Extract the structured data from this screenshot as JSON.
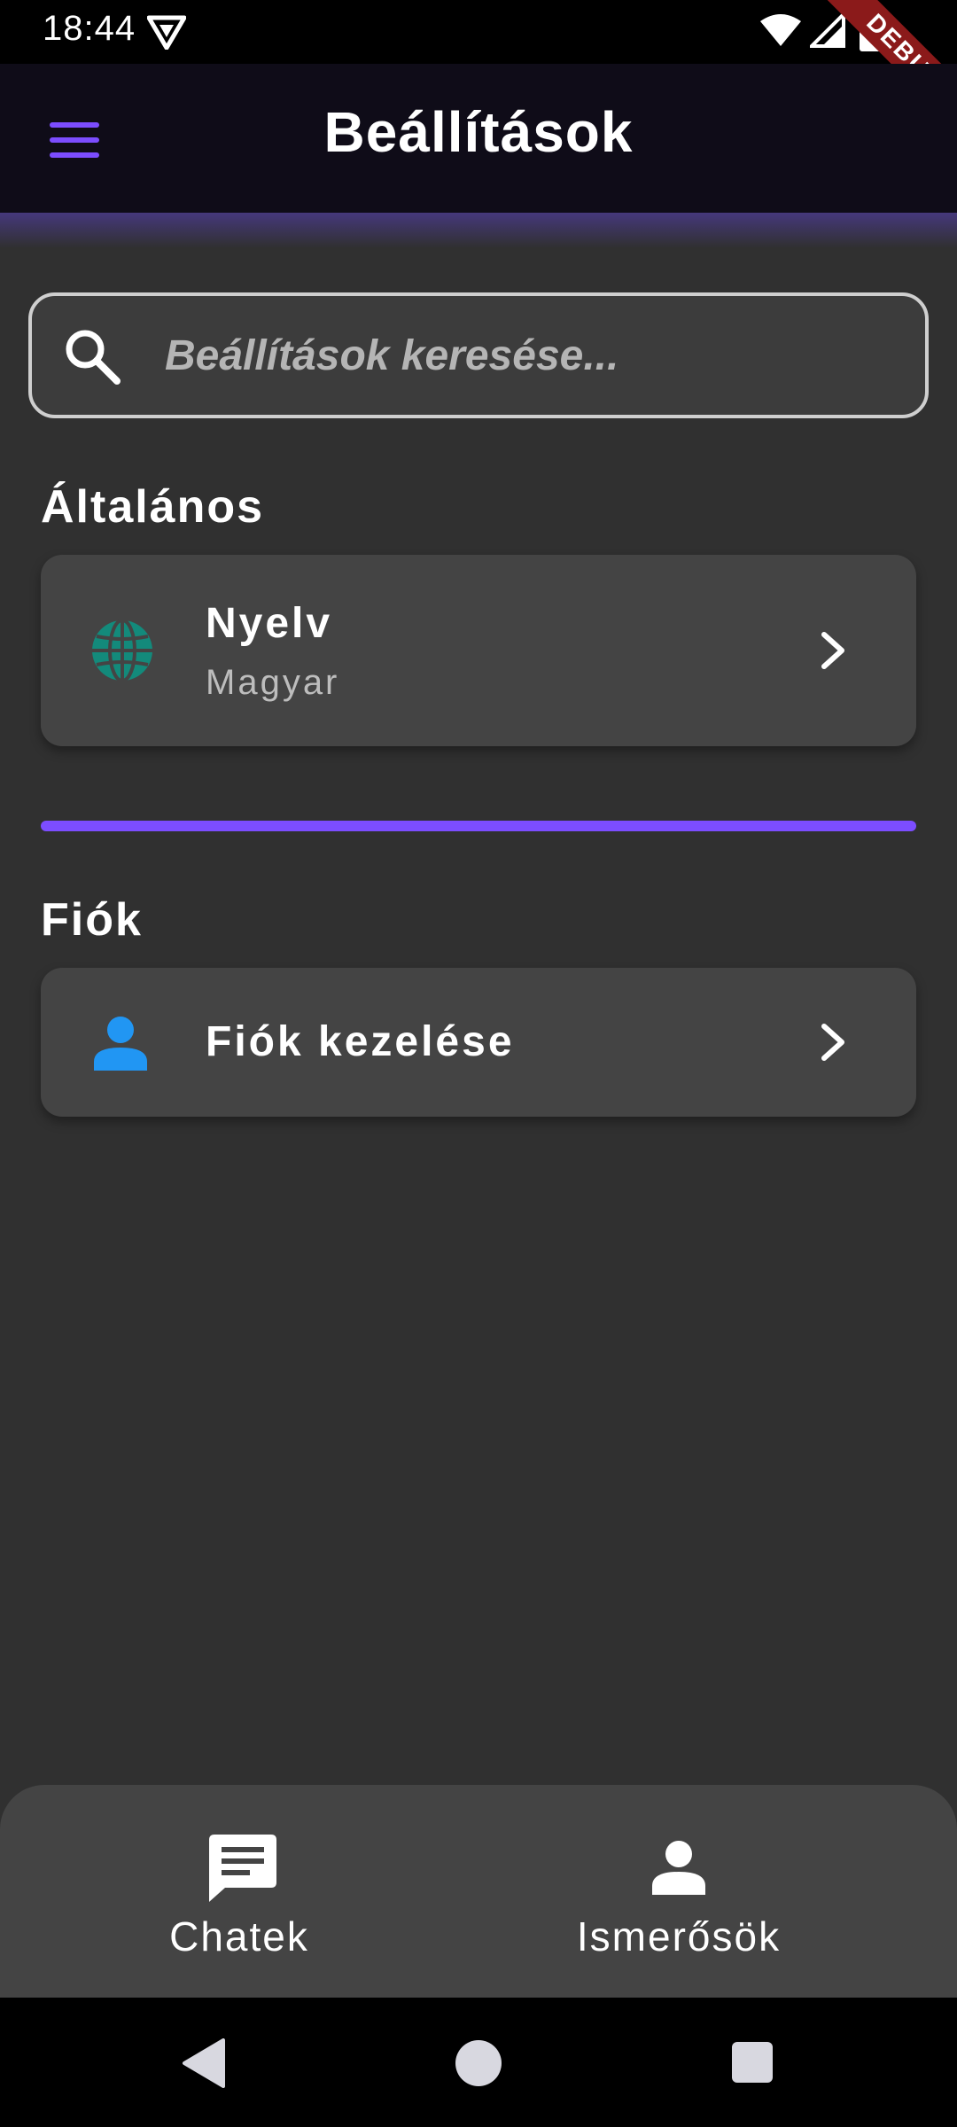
{
  "status_bar": {
    "time": "18:44",
    "debug_label": "DEBUG"
  },
  "app_bar": {
    "title": "Beállítások",
    "accent_color": "#7c4dff"
  },
  "search": {
    "placeholder": "Beállítások keresése..."
  },
  "sections": {
    "general": {
      "title": "Általános",
      "language": {
        "title": "Nyelv",
        "subtitle": "Magyar",
        "icon": "globe-icon",
        "icon_color": "#138a7b"
      }
    },
    "account": {
      "title": "Fiók",
      "manage": {
        "title": "Fiók kezelése",
        "icon": "person-icon",
        "icon_color": "#2196f3"
      }
    }
  },
  "bottom_nav": {
    "chats": {
      "label": "Chatek",
      "icon": "chat-icon"
    },
    "contacts": {
      "label": "Ismerősök",
      "icon": "person-icon"
    }
  }
}
